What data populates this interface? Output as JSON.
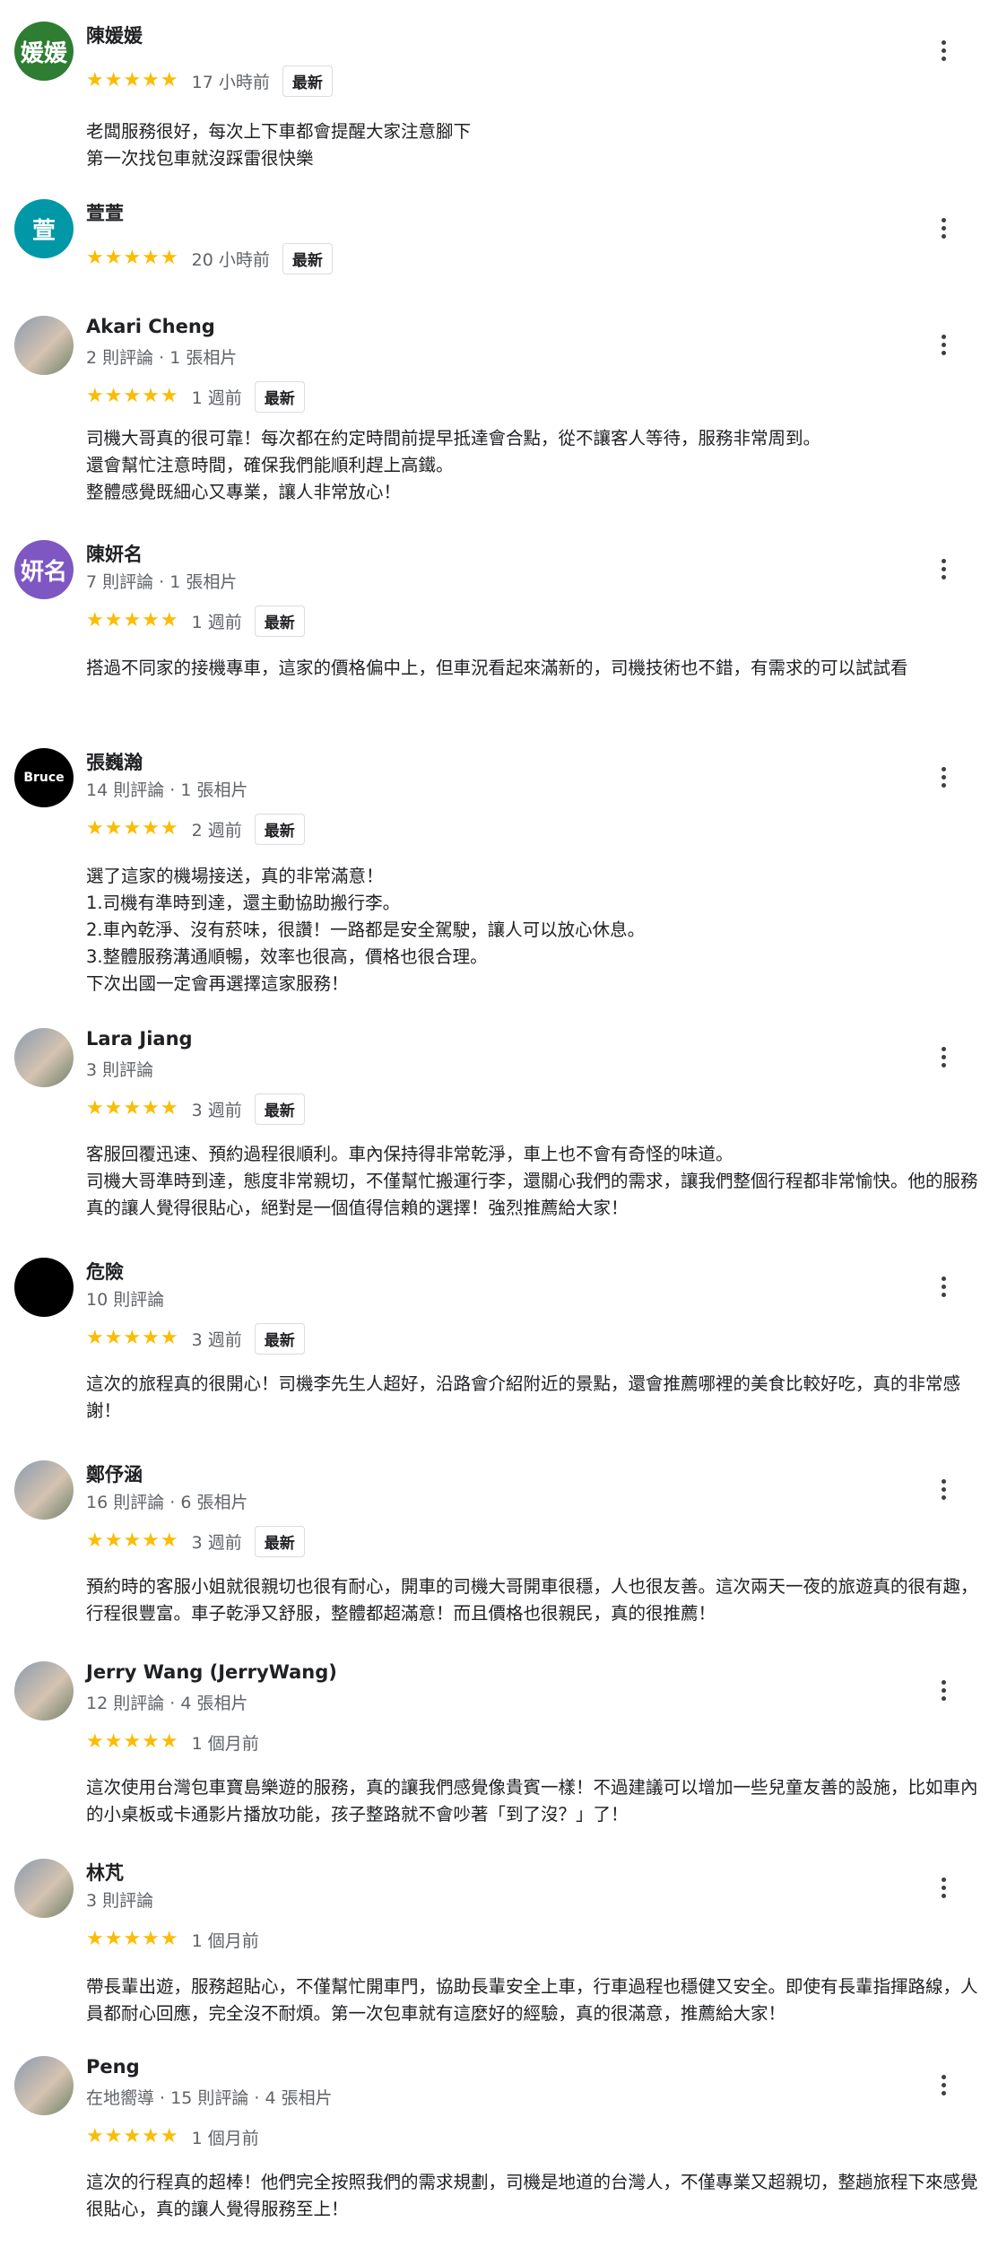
{
  "reviews": [
    {
      "name": "陳媛媛",
      "meta": "",
      "time": "17 小時前",
      "badge": "最新",
      "avatar": {
        "type": "letter",
        "text": "媛媛",
        "color": "#2e7d32"
      },
      "text": "老闆服務很好，每次上下車都會提醒大家注意腳下\n第一次找包車就沒踩雷很快樂"
    },
    {
      "name": "萱萱",
      "meta": "",
      "time": "20 小時前",
      "badge": "最新",
      "avatar": {
        "type": "letter",
        "text": "萱",
        "color": "#0097a7"
      },
      "text": ""
    },
    {
      "name": "Akari Cheng",
      "meta": "2 則評論 · 1 張相片",
      "time": "1 週前",
      "badge": "最新",
      "avatar": {
        "type": "photo",
        "text": "",
        "color": "#7a8a9c"
      },
      "text": "司機大哥真的很可靠！每次都在約定時間前提早抵達會合點，從不讓客人等待，服務非常周到。\n還會幫忙注意時間，確保我們能順利趕上高鐵。\n整體感覺既細心又專業，讓人非常放心！"
    },
    {
      "name": "陳妍名",
      "meta": "7 則評論 · 1 張相片",
      "time": "1 週前",
      "badge": "最新",
      "avatar": {
        "type": "letter",
        "text": "妍名",
        "color": "#7e57c2"
      },
      "text": "搭過不同家的接機專車，這家的價格偏中上，但車況看起來滿新的，司機技術也不錯，有需求的可以試試看"
    },
    {
      "name": "張巍瀚",
      "meta": "14 則評論 · 1 張相片",
      "time": "2 週前",
      "badge": "最新",
      "avatar": {
        "type": "letter",
        "text": "Bruce",
        "color": "#000000"
      },
      "text": "選了這家的機場接送，真的非常滿意！\n1.司機有準時到達，還主動協助搬行李。\n2.車內乾淨、沒有菸味，很讚！一路都是安全駕駛，讓人可以放心休息。\n3.整體服務溝通順暢，效率也很高，價格也很合理。\n下次出國一定會再選擇這家服務！"
    },
    {
      "name": "Lara Jiang",
      "meta": "3 則評論",
      "time": "3 週前",
      "badge": "最新",
      "avatar": {
        "type": "photo",
        "text": "",
        "color": "#b0a08a"
      },
      "text": "客服回覆迅速、預約過程很順利。車內保持得非常乾淨，車上也不會有奇怪的味道。\n司機大哥準時到達，態度非常親切，不僅幫忙搬運行李，還關心我們的需求，讓我們整個行程都非常愉快。他的服務真的讓人覺得很貼心，絕對是一個值得信賴的選擇！強烈推薦給大家！"
    },
    {
      "name": "危險",
      "meta": "10 則評論",
      "time": "3 週前",
      "badge": "最新",
      "avatar": {
        "type": "letter",
        "text": "",
        "color": "#000000"
      },
      "text": "這次的旅程真的很開心！司機李先生人超好，沿路會介紹附近的景點，還會推薦哪裡的美食比較好吃，真的非常感謝！"
    },
    {
      "name": "鄭伃涵",
      "meta": "16 則評論 · 6 張相片",
      "time": "3 週前",
      "badge": "最新",
      "avatar": {
        "type": "photo",
        "text": "",
        "color": "#6b5a4e"
      },
      "text": "預約時的客服小姐就很親切也很有耐心，開車的司機大哥開車很穩，人也很友善。這次兩天一夜的旅遊真的很有趣，行程很豐富。車子乾淨又舒服，整體都超滿意！而且價格也很親民，真的很推薦！"
    },
    {
      "name": "Jerry Wang (JerryWang)",
      "meta": "12 則評論 · 4 張相片",
      "time": "1 個月前",
      "badge": "",
      "avatar": {
        "type": "photo",
        "text": "",
        "color": "#8c8c7e"
      },
      "text": "這次使用台灣包車寶島樂遊的服務，真的讓我們感覺像貴賓一樣！不過建議可以增加一些兒童友善的設施，比如車內的小桌板或卡通影片播放功能，孩子整路就不會吵著「到了沒？」了！"
    },
    {
      "name": "林芃",
      "meta": "3 則評論",
      "time": "1 個月前",
      "badge": "",
      "avatar": {
        "type": "photo",
        "text": "",
        "color": "#9a7f72"
      },
      "text": "帶長輩出遊，服務超貼心，不僅幫忙開車門，協助長輩安全上車，行車過程也穩健又安全。即使有長輩指揮路線，人員都耐心回應，完全沒不耐煩。第一次包車就有這麼好的經驗，真的很滿意，推薦給大家！"
    },
    {
      "name": "Peng",
      "meta": "在地嚮導 · 15 則評論 · 4 張相片",
      "time": "1 個月前",
      "badge": "",
      "avatar": {
        "type": "photo",
        "text": "",
        "color": "#5f8fbf"
      },
      "text": "這次的行程真的超棒！他們完全按照我們的需求規劃，司機是地道的台灣人，不僅專業又超親切，整趟旅程下來感覺很貼心，真的讓人覺得服務至上！"
    }
  ],
  "stars": "★★★★★"
}
